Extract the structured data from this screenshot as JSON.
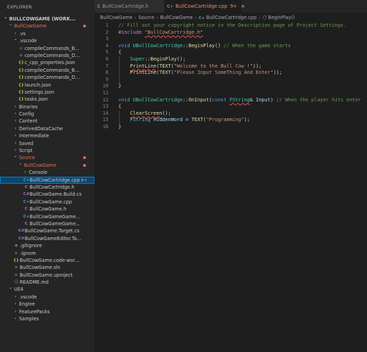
{
  "sidebar": {
    "title": "EXPLORER",
    "items": [
      {
        "label": "BULLCOWGAME (WORK...",
        "depth": 0,
        "chevron": "down",
        "icon": "",
        "status": "plain",
        "dot": false,
        "root": true
      },
      {
        "label": "BullCowGame",
        "depth": 1,
        "chevron": "down",
        "icon": "",
        "status": "modified",
        "dot": true
      },
      {
        "label": ".vs",
        "depth": 2,
        "chevron": "right",
        "icon": "",
        "status": "plain"
      },
      {
        "label": ".vscode",
        "depth": 2,
        "chevron": "down",
        "icon": "",
        "status": "plain"
      },
      {
        "label": "compileCommands_BullCowGame",
        "depth": 3,
        "chevron": "",
        "icon": "lines",
        "status": "plain"
      },
      {
        "label": "compileCommands_Default",
        "depth": 3,
        "chevron": "",
        "icon": "lines",
        "status": "plain"
      },
      {
        "label": "c_cpp_properties.json",
        "depth": 3,
        "chevron": "",
        "icon": "braces",
        "status": "plain"
      },
      {
        "label": "compileCommands_BullCowGame...",
        "depth": 3,
        "chevron": "",
        "icon": "braces",
        "status": "plain"
      },
      {
        "label": "compileCommands_Default.json",
        "depth": 3,
        "chevron": "",
        "icon": "braces",
        "status": "plain"
      },
      {
        "label": "launch.json",
        "depth": 3,
        "chevron": "",
        "icon": "braces",
        "status": "plain"
      },
      {
        "label": "settings.json",
        "depth": 3,
        "chevron": "",
        "icon": "braces",
        "status": "plain"
      },
      {
        "label": "tasks.json",
        "depth": 3,
        "chevron": "",
        "icon": "braces",
        "status": "plain"
      },
      {
        "label": "Binaries",
        "depth": 2,
        "chevron": "right",
        "icon": "",
        "status": "plain"
      },
      {
        "label": "Config",
        "depth": 2,
        "chevron": "right",
        "icon": "",
        "status": "plain"
      },
      {
        "label": "Content",
        "depth": 2,
        "chevron": "right",
        "icon": "",
        "status": "plain"
      },
      {
        "label": "DerivedDataCache",
        "depth": 2,
        "chevron": "right",
        "icon": "",
        "status": "plain"
      },
      {
        "label": "Intermediate",
        "depth": 2,
        "chevron": "right",
        "icon": "",
        "status": "plain"
      },
      {
        "label": "Saved",
        "depth": 2,
        "chevron": "right",
        "icon": "",
        "status": "plain"
      },
      {
        "label": "Script",
        "depth": 2,
        "chevron": "right",
        "icon": "",
        "status": "plain"
      },
      {
        "label": "Source",
        "depth": 2,
        "chevron": "down",
        "icon": "",
        "status": "modified",
        "dot": true
      },
      {
        "label": "BullCowGame",
        "depth": 3,
        "chevron": "down",
        "icon": "",
        "status": "modified",
        "dot": true
      },
      {
        "label": "Console",
        "depth": 4,
        "chevron": "right",
        "icon": "",
        "status": "plain"
      },
      {
        "label": "BullCowCartridge.cpp",
        "depth": 4,
        "chevron": "",
        "icon": "cpp",
        "status": "plain",
        "badge": "9+",
        "selected": true
      },
      {
        "label": "BullCowCartridge.h",
        "depth": 4,
        "chevron": "",
        "icon": "h",
        "status": "plain"
      },
      {
        "label": "BullCowGame.Build.cs",
        "depth": 4,
        "chevron": "",
        "icon": "cs",
        "status": "plain"
      },
      {
        "label": "BullCowGame.cpp",
        "depth": 4,
        "chevron": "",
        "icon": "cpp",
        "status": "plain"
      },
      {
        "label": "BullCowGame.h",
        "depth": 4,
        "chevron": "",
        "icon": "h",
        "status": "plain"
      },
      {
        "label": "BullCowGameGameModeBase.cpp",
        "depth": 4,
        "chevron": "",
        "icon": "cpp",
        "status": "plain"
      },
      {
        "label": "BullCowGameGameModeBase.h",
        "depth": 4,
        "chevron": "",
        "icon": "h",
        "status": "plain"
      },
      {
        "label": "BullCowGame.Target.cs",
        "depth": 3,
        "chevron": "",
        "icon": "cs",
        "status": "plain"
      },
      {
        "label": "BullCowGameEditor.Target.cs",
        "depth": 3,
        "chevron": "",
        "icon": "cs",
        "status": "plain"
      },
      {
        "label": ".gitignore",
        "depth": 2,
        "chevron": "",
        "icon": "git",
        "status": "plain"
      },
      {
        "label": ".ignore",
        "depth": 2,
        "chevron": "",
        "icon": "lines",
        "status": "plain"
      },
      {
        "label": "BullCowGame.code-workspace",
        "depth": 2,
        "chevron": "",
        "icon": "braces",
        "status": "plain"
      },
      {
        "label": "BullCowGame.sln",
        "depth": 2,
        "chevron": "",
        "icon": "lines",
        "status": "plain"
      },
      {
        "label": "BullCowGame.uproject",
        "depth": 2,
        "chevron": "",
        "icon": "lines",
        "status": "plain"
      },
      {
        "label": "README.md",
        "depth": 2,
        "chevron": "",
        "icon": "readme",
        "status": "plain"
      },
      {
        "label": "UE4",
        "depth": 1,
        "chevron": "down",
        "icon": "",
        "status": "plain"
      },
      {
        "label": ".vscode",
        "depth": 2,
        "chevron": "right",
        "icon": "",
        "status": "plain"
      },
      {
        "label": "Engine",
        "depth": 2,
        "chevron": "right",
        "icon": "",
        "status": "plain"
      },
      {
        "label": "FeaturePacks",
        "depth": 2,
        "chevron": "right",
        "icon": "",
        "status": "plain"
      },
      {
        "label": "Samples",
        "depth": 2,
        "chevron": "right",
        "icon": "",
        "status": "plain"
      }
    ]
  },
  "tabs": [
    {
      "label": "BullCowCartridge.h",
      "icon": "C",
      "active": false,
      "badge": "",
      "close": ""
    },
    {
      "label": "BullCowCartridge.cpp",
      "icon": "C+",
      "active": true,
      "badge": "9+",
      "close": "×"
    }
  ],
  "breadcrumb": [
    "BullCowGame",
    "Source",
    "BullCowGame",
    "BullCowCartridge.cpp",
    "BeginPlay()"
  ],
  "code": [
    [
      [
        "comment",
        "// Fill out your copyright notice in the Description page of Project Settings."
      ]
    ],
    [
      [
        "directive",
        "#include "
      ],
      [
        "string",
        "\"BullCowCartridge.h\"",
        "sq"
      ]
    ],
    [],
    [
      [
        "keyword",
        "void "
      ],
      [
        "type",
        "UBullCowCartridge"
      ],
      [
        "punct",
        "::"
      ],
      [
        "func",
        "BeginPlay"
      ],
      [
        "punct",
        "() "
      ],
      [
        "comment",
        "// When the game starts"
      ]
    ],
    [
      [
        "punct",
        "{"
      ]
    ],
    [
      [
        "punct",
        "    "
      ],
      [
        "type",
        "Super"
      ],
      [
        "punct",
        "::"
      ],
      [
        "func",
        "BeginPlay"
      ],
      [
        "punct",
        "();"
      ]
    ],
    [
      [
        "punct",
        "    "
      ],
      [
        "func",
        "PrintLine",
        "sq"
      ],
      [
        "punct",
        "("
      ],
      [
        "func",
        "TEXT"
      ],
      [
        "punct",
        "("
      ],
      [
        "string",
        "\"Welcome to the Bull Cow !\""
      ],
      [
        "punct",
        "));"
      ]
    ],
    [
      [
        "punct",
        "    "
      ],
      [
        "func",
        "PrintLine"
      ],
      [
        "punct",
        "("
      ],
      [
        "func",
        "TEXT"
      ],
      [
        "punct",
        "("
      ],
      [
        "string",
        "\"Please Input SomeThing And Enter\""
      ],
      [
        "punct",
        "));"
      ]
    ],
    [],
    [
      [
        "punct",
        "}"
      ]
    ],
    [],
    [
      [
        "keyword",
        "void "
      ],
      [
        "type",
        "UBullCowCartridge"
      ],
      [
        "punct",
        "::"
      ],
      [
        "func",
        "OnInput"
      ],
      [
        "punct",
        "("
      ],
      [
        "keyword",
        "const "
      ],
      [
        "type",
        "FString",
        "sq"
      ],
      [
        "punct",
        "& "
      ],
      [
        "var",
        "Input"
      ],
      [
        "punct",
        ") "
      ],
      [
        "comment",
        "// When the player hits enter"
      ]
    ],
    [
      [
        "punct",
        "{"
      ]
    ],
    [
      [
        "punct",
        "    "
      ],
      [
        "func",
        "ClearScreen",
        "sq"
      ],
      [
        "punct",
        "();"
      ]
    ],
    [
      [
        "punct",
        "    "
      ],
      [
        "type",
        "FString "
      ],
      [
        "var",
        "HiddenWord"
      ],
      [
        "punct",
        " = "
      ],
      [
        "func",
        "TEXT"
      ],
      [
        "punct",
        "("
      ],
      [
        "string",
        "\"Programming\""
      ],
      [
        "punct",
        ");"
      ]
    ],
    [
      [
        "punct",
        "}"
      ]
    ]
  ],
  "colors": {
    "sidebar_bg": "#252526",
    "editor_bg": "#1e1e1e",
    "selection": "#094771",
    "modified": "#e2735a",
    "error": "#f48771"
  }
}
